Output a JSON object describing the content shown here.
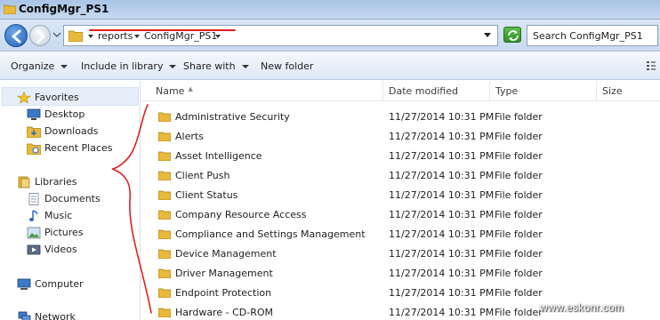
{
  "window": {
    "title": "ConfigMgr_PS1"
  },
  "address": {
    "crumbs": [
      "reports",
      "ConfigMgr_PS1"
    ],
    "search_placeholder": "Search ConfigMgr_PS1"
  },
  "toolbar": {
    "organize": "Organize",
    "include": "Include in library",
    "share": "Share with",
    "new_folder": "New folder"
  },
  "nav": {
    "favorites": "Favorites",
    "desktop": "Desktop",
    "downloads": "Downloads",
    "recent": "Recent Places",
    "libraries": "Libraries",
    "documents": "Documents",
    "music": "Music",
    "pictures": "Pictures",
    "videos": "Videos",
    "computer": "Computer",
    "network": "Network"
  },
  "columns": {
    "name": "Name",
    "date": "Date modified",
    "type": "Type",
    "size": "Size"
  },
  "files": [
    {
      "name": "Administrative Security",
      "date": "11/27/2014 10:31 PM",
      "type": "File folder"
    },
    {
      "name": "Alerts",
      "date": "11/27/2014 10:31 PM",
      "type": "File folder"
    },
    {
      "name": "Asset Intelligence",
      "date": "11/27/2014 10:31 PM",
      "type": "File folder"
    },
    {
      "name": "Client Push",
      "date": "11/27/2014 10:31 PM",
      "type": "File folder"
    },
    {
      "name": "Client Status",
      "date": "11/27/2014 10:31 PM",
      "type": "File folder"
    },
    {
      "name": "Company Resource Access",
      "date": "11/27/2014 10:31 PM",
      "type": "File folder"
    },
    {
      "name": "Compliance and Settings Management",
      "date": "11/27/2014 10:31 PM",
      "type": "File folder"
    },
    {
      "name": "Device Management",
      "date": "11/27/2014 10:31 PM",
      "type": "File folder"
    },
    {
      "name": "Driver Management",
      "date": "11/27/2014 10:31 PM",
      "type": "File folder"
    },
    {
      "name": "Endpoint Protection",
      "date": "11/27/2014 10:31 PM",
      "type": "File folder"
    },
    {
      "name": "Hardware - CD-ROM",
      "date": "11/27/2014 10:31 PM",
      "type": "File folder"
    }
  ],
  "watermark": "www.eskonr.com"
}
